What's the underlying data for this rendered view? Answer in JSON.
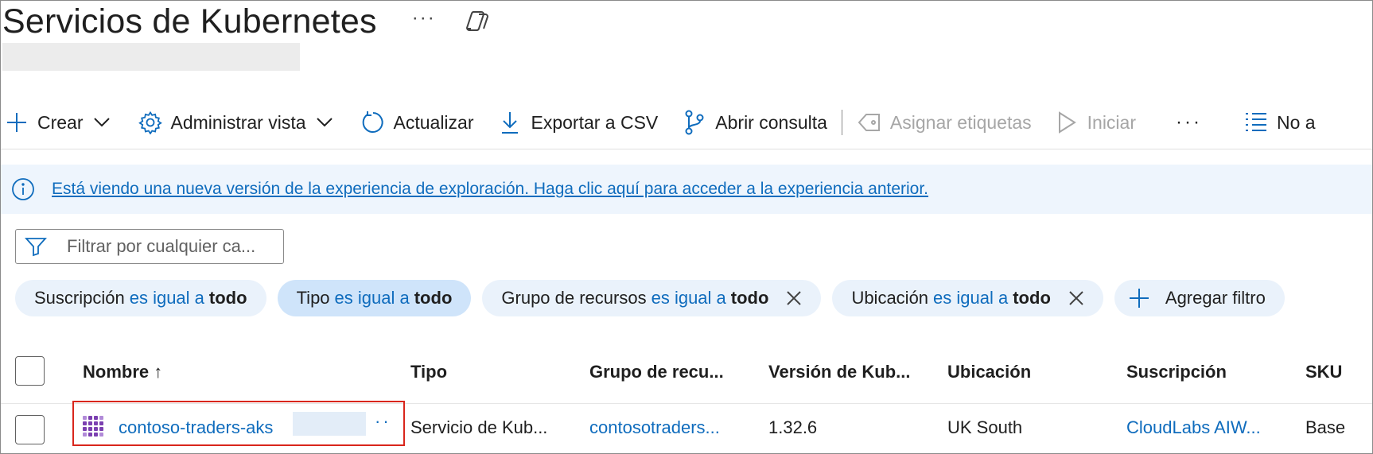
{
  "page": {
    "title": "Servicios de Kubernetes",
    "title_more": "···"
  },
  "toolbar": {
    "create": "Crear",
    "manage_view": "Administrar vista",
    "refresh": "Actualizar",
    "export_csv": "Exportar a CSV",
    "open_query": "Abrir consulta",
    "assign_tags": "Asignar etiquetas",
    "start": "Iniciar",
    "more": "···",
    "no_grouping": "No a"
  },
  "info_bar": {
    "message": "Está viendo una nueva versión de la experiencia de exploración. Haga clic aquí para acceder a la experiencia anterior."
  },
  "filter": {
    "placeholder": "Filtrar por cualquier ca..."
  },
  "filter_pills": [
    {
      "key": "Suscripción",
      "op": "es igual a",
      "value": "todo"
    },
    {
      "key": "Tipo",
      "op": "es igual a",
      "value": "todo"
    },
    {
      "key": "Grupo de recursos",
      "op": "es igual a",
      "value": "todo"
    },
    {
      "key": "Ubicación",
      "op": "es igual a",
      "value": "todo"
    }
  ],
  "add_filter": "Agregar filtro",
  "table": {
    "columns": [
      "Nombre ↑",
      "Tipo",
      "Grupo de recu...",
      "Versión de Kub...",
      "Ubicación",
      "Suscripción",
      "SKU"
    ],
    "rows": [
      {
        "name": "contoso-traders-aks",
        "row_more": "··",
        "type": "Servicio de Kub...",
        "resource_group": "contosotraders...",
        "version": "1.32.6",
        "location": "UK South",
        "subscription": "CloudLabs AIW...",
        "sku": "Base"
      }
    ]
  },
  "colors": {
    "accent": "#0f6cbd",
    "info_bg": "#eef5fd",
    "highlight": "#d9261c",
    "kubernetes_purple": "#7b3fb0"
  }
}
